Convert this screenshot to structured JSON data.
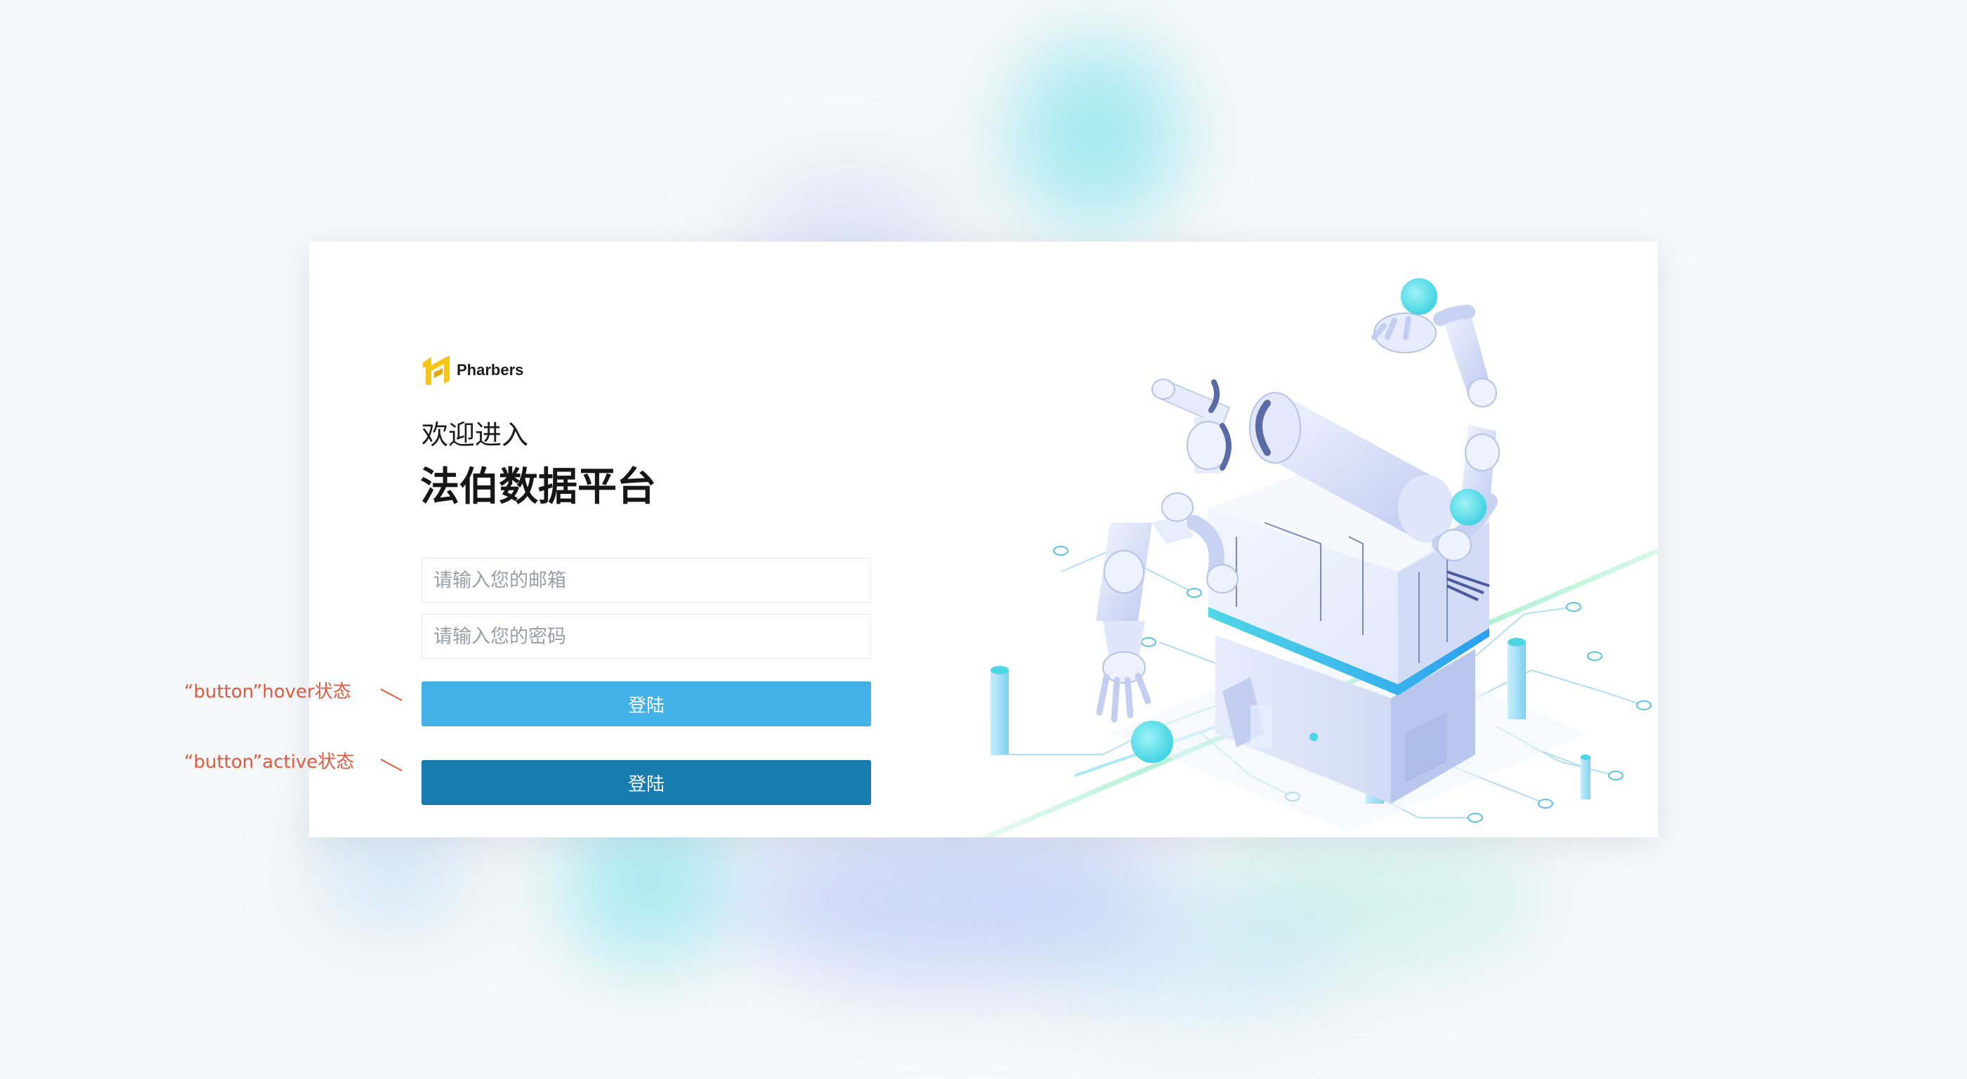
{
  "brand": {
    "name": "Pharbers",
    "accent_color": "#f5c518"
  },
  "welcome": {
    "line1": "欢迎进入",
    "line2": "法伯数据平台"
  },
  "form": {
    "email": {
      "placeholder": "请输入您的邮箱",
      "value": ""
    },
    "password": {
      "placeholder": "请输入您的密码",
      "value": ""
    }
  },
  "buttons": {
    "login_hover": {
      "label": "登陆",
      "color": "#41b1e7"
    },
    "login_active": {
      "label": "登陆",
      "color": "#177cb0"
    }
  },
  "annotations": {
    "hover_note": "“button”hover状态",
    "active_note": "“button”active状态",
    "color": "#e5583d"
  },
  "illustration": {
    "icon": "robot-arms-isometric-illustration",
    "accent_colors": [
      "#4fd6e6",
      "#dfe8fb",
      "#8ea2d8",
      "#7be8b8"
    ]
  }
}
